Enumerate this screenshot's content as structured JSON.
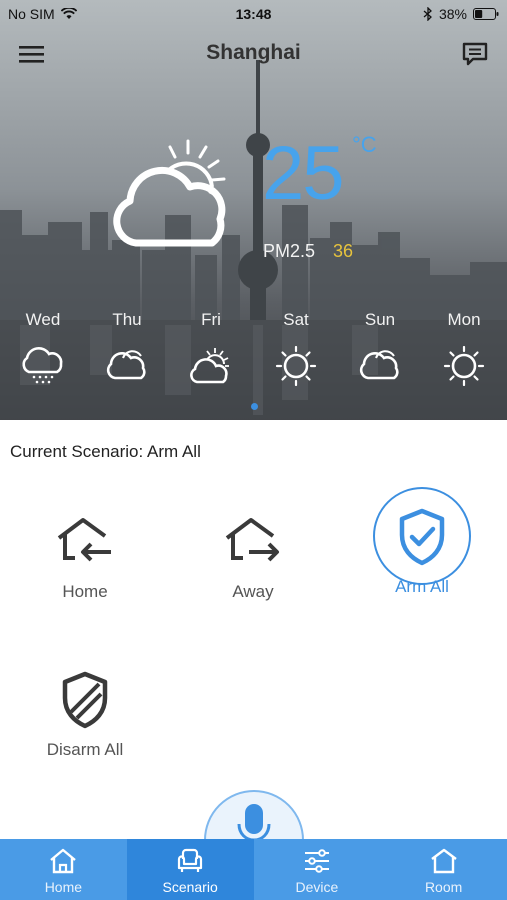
{
  "status_bar": {
    "carrier": "No SIM",
    "time": "13:48",
    "battery": "38%",
    "battery_level": 0.38
  },
  "header": {
    "city": "Shanghai"
  },
  "weather": {
    "temperature": "25",
    "unit": "°C",
    "pm_label": "PM2.5",
    "pm_value": "36",
    "current_icon": "cloud-sun-icon",
    "forecast": [
      {
        "day": "Wed",
        "icon": "cloud-rain-icon"
      },
      {
        "day": "Thu",
        "icon": "cloud-icon"
      },
      {
        "day": "Fri",
        "icon": "cloud-sun-icon"
      },
      {
        "day": "Sat",
        "icon": "sun-icon"
      },
      {
        "day": "Sun",
        "icon": "cloud-icon"
      },
      {
        "day": "Mon",
        "icon": "sun-icon"
      }
    ]
  },
  "scenario": {
    "current_label": "Current Scenario: Arm All",
    "items": [
      {
        "label": "Home",
        "icon": "home-arrive-icon",
        "active": false
      },
      {
        "label": "Away",
        "icon": "home-leave-icon",
        "active": false
      },
      {
        "label": "Arm All",
        "icon": "shield-check-icon",
        "active": true
      },
      {
        "label": "Disarm All",
        "icon": "shield-off-icon",
        "active": false
      }
    ]
  },
  "tabs": [
    {
      "label": "Home",
      "icon": "house-icon",
      "active": false
    },
    {
      "label": "Scenario",
      "icon": "armchair-icon",
      "active": true
    },
    {
      "label": "Device",
      "icon": "sliders-icon",
      "active": false
    },
    {
      "label": "Room",
      "icon": "room-icon",
      "active": false
    }
  ],
  "colors": {
    "accent": "#3c8fe0",
    "temperature": "#47a3ec",
    "pm_value": "#e7c33d",
    "tabbar": "#4a9be6"
  }
}
